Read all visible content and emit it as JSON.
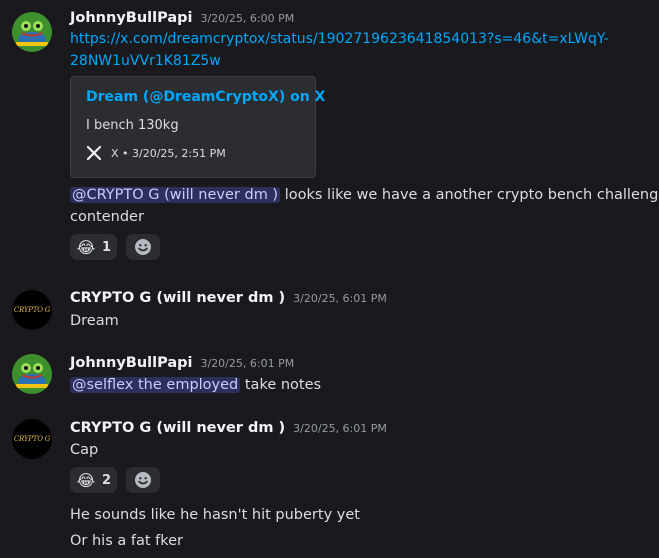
{
  "messages": [
    {
      "author": "JohnnyBullPapi",
      "timestamp": "3/20/25, 6:00 PM",
      "link_line1": "https://x.com/dreamcryptox/status/1902719623641854013?s=46&t=xLWqY-",
      "link_line2": "28NW1uVVr1K81Z5w",
      "embed": {
        "title": "Dream (@DreamCryptoX) on X",
        "description": "I bench 130kg",
        "footer": "X • 3/20/25, 2:51 PM"
      },
      "mention": "@CRYPTO G (will never dm )",
      "text_after_mention": " looks like we have a another crypto bench challenge",
      "text_line2": "contender",
      "reaction": {
        "emoji": "😂",
        "count": "1"
      }
    },
    {
      "author": "CRYPTO G (will never dm )",
      "timestamp": "3/20/25, 6:01 PM",
      "avatar_text": "CRYPTO G",
      "text": "Dream"
    },
    {
      "author": "JohnnyBullPapi",
      "timestamp": "3/20/25, 6:01 PM",
      "mention": "@selflex the employed",
      "text_after_mention": " take notes"
    },
    {
      "author": "CRYPTO G (will never dm )",
      "timestamp": "3/20/25, 6:01 PM",
      "avatar_text": "CRYPTO G",
      "text": "Cap",
      "reaction": {
        "emoji": "😂",
        "count": "2"
      },
      "followups": [
        "He sounds like he hasn't hit puberty yet",
        "Or his a fat fker"
      ]
    }
  ],
  "icons": {
    "x_logo": "x-logo-icon",
    "add_reaction": "add-reaction-smiley-icon"
  },
  "colors": {
    "background": "#1a1a1e",
    "link": "#00a8fc",
    "mention_bg": "#3b4080",
    "embed_bg": "#2b2d31",
    "timestamp": "#949ba4"
  }
}
